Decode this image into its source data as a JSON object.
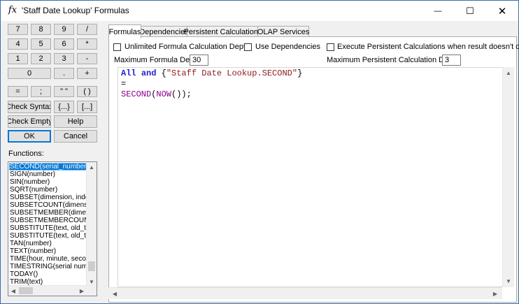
{
  "window": {
    "title": "'Staff Date Lookup' Formulas",
    "icon": "fx",
    "minimize_glyph": "—",
    "maximize_glyph": "☐",
    "close_glyph": "✕"
  },
  "keypad": {
    "row1": [
      "7",
      "8",
      "9",
      "/"
    ],
    "row2": [
      "4",
      "5",
      "6",
      "*"
    ],
    "row3": [
      "1",
      "2",
      "3",
      "-"
    ],
    "row4": [
      "0",
      ".",
      "+"
    ],
    "row5": [
      "=",
      ";",
      "\" \"",
      "( )"
    ],
    "row6": [
      "Check Syntax",
      "{...}",
      "[...]"
    ],
    "row7": [
      "Check Empty",
      "Help"
    ],
    "row8": [
      "OK",
      "Cancel"
    ]
  },
  "functions": {
    "label": "Functions:",
    "items": [
      "SECOND(serial_number)",
      "SIGN(number)",
      "SIN(number)",
      "SQRT(number)",
      "SUBSET(dimension, index)",
      "SUBSETCOUNT(dimension",
      "SUBSETMEMBER(dimensi",
      "SUBSETMEMBERCOUNT",
      "SUBSTITUTE(text, old_tex",
      "SUBSTITUTE(text, old_tex",
      "TAN(number)",
      "TEXT(number)",
      "TIME(hour, minute, second",
      "TIMESTRING(serial numbe",
      "TODAY()",
      "TRIM(text)"
    ],
    "selected_index": 0
  },
  "tabs": [
    "Formulas",
    "Dependencies",
    "Persistent Calculations",
    "OLAP Services"
  ],
  "active_tab": 0,
  "options": {
    "unlimited_depth_label": "Unlimited Formula Calculation Depth",
    "use_dependencies_label": "Use Dependencies",
    "execute_persistent_label": "Execute Persistent Calculations when result doesn't change",
    "max_formula_depth_label": "Maximum Formula Depth:",
    "max_formula_depth_value": "30",
    "max_persistent_depth_label": "Maximum Persistent Calculation Depth:",
    "max_persistent_depth_value": "3"
  },
  "editor": {
    "line1_kw_all": "All",
    "line1_kw_and": "and",
    "line1_open": "{",
    "line1_string": "\"Staff Date Lookup.SECOND\"",
    "line1_close": "}",
    "line2": "=",
    "line3_fn_second": "SECOND",
    "line3_open": "(",
    "line3_fn_now": "NOW",
    "line3_close": "());"
  },
  "colors": {
    "keyword": "#1f1fd0",
    "string": "#8b1a1a",
    "function": "#8b008b",
    "selection": "#0078d7",
    "default_button_border": "#0078d7"
  }
}
